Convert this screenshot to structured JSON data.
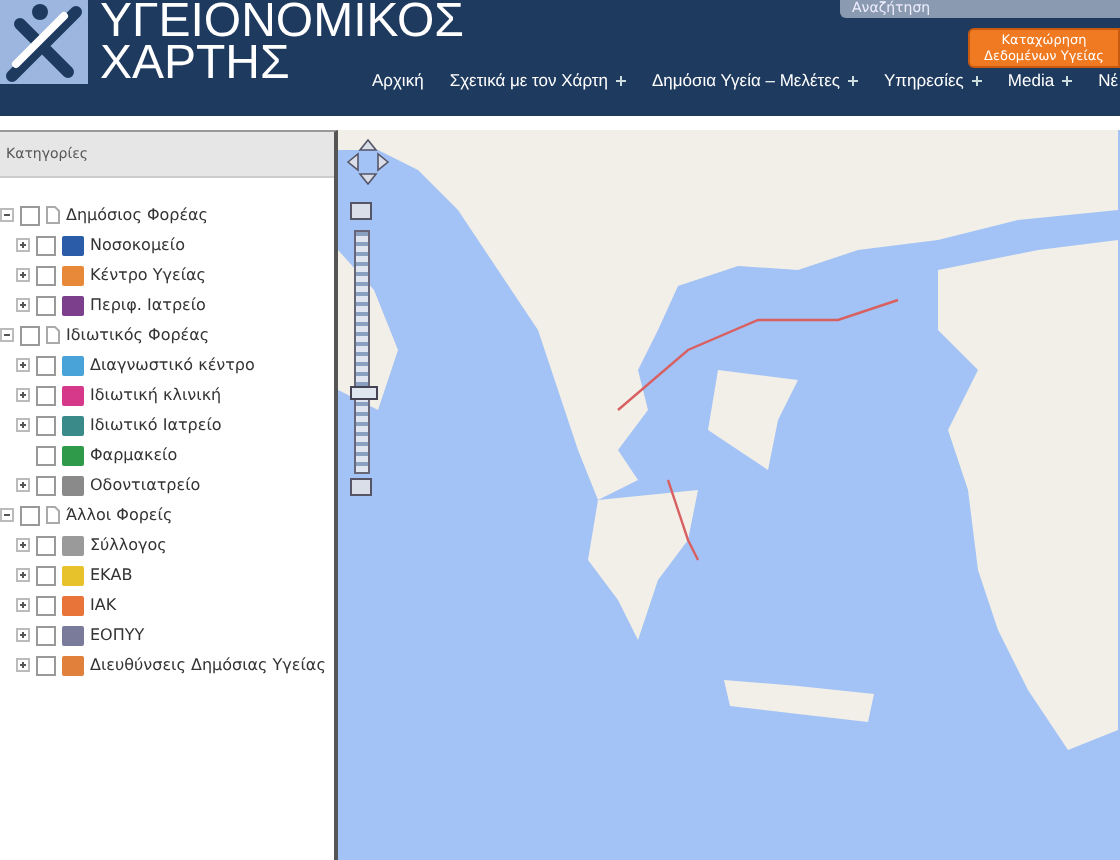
{
  "header": {
    "logo_line_1": "ΥΓΕΙΟΝΟΜΙΚΟΣ",
    "logo_line_2": "ΧΑΡΤΗΣ",
    "search": {
      "placeholder": "Αναζήτηση"
    },
    "register_button": "Καταχώρηση Δεδομένων Υγείας"
  },
  "nav": [
    {
      "label": "Αρχική",
      "expander": false
    },
    {
      "label": "Σχετικά με τον Χάρτη",
      "expander": true
    },
    {
      "label": "Δημόσια Υγεία – Μελέτες",
      "expander": true
    },
    {
      "label": "Υπηρεσίες",
      "expander": true
    },
    {
      "label": "Media",
      "expander": true
    },
    {
      "label": "Νέ",
      "expander": false
    }
  ],
  "sidebar": {
    "title": "Κατηγορίες",
    "tree": [
      {
        "label": "Δημόσιος Φορέας",
        "kind": "group",
        "expanded": true,
        "checked": false,
        "children": [
          {
            "label": "Νοσοκομείο",
            "kind": "category",
            "expanded": false,
            "checked": false,
            "color": "#2a5ca8"
          },
          {
            "label": "Κέντρο Υγείας",
            "kind": "category",
            "expanded": false,
            "checked": false,
            "color": "#e8893a"
          },
          {
            "label": "Περιφ. Ιατρείο",
            "kind": "category",
            "expanded": false,
            "checked": false,
            "color": "#7b3f8c"
          }
        ]
      },
      {
        "label": "Ιδιωτικός Φορέας",
        "kind": "group",
        "expanded": true,
        "checked": false,
        "children": [
          {
            "label": "Διαγνωστικό κέντρο",
            "kind": "category",
            "expanded": false,
            "checked": false,
            "color": "#4aa3d8"
          },
          {
            "label": "Ιδιωτική κλινική",
            "kind": "category",
            "expanded": false,
            "checked": false,
            "color": "#d6398a"
          },
          {
            "label": "Ιδιωτικό Ιατρείο",
            "kind": "category",
            "expanded": false,
            "checked": false,
            "color": "#3a8a8a"
          },
          {
            "label": "Φαρμακείο",
            "kind": "leaf",
            "checked": false,
            "color": "#2e9a4a"
          },
          {
            "label": "Οδοντιατρείο",
            "kind": "category",
            "expanded": false,
            "checked": false,
            "color": "#8a8a8a"
          }
        ]
      },
      {
        "label": "Άλλοι Φορείς",
        "kind": "group",
        "expanded": true,
        "checked": false,
        "children": [
          {
            "label": "Σύλλογος",
            "kind": "category",
            "expanded": false,
            "checked": false,
            "color": "#9a9a9a"
          },
          {
            "label": "ΕΚΑΒ",
            "kind": "category",
            "expanded": false,
            "checked": false,
            "color": "#e8c22a"
          },
          {
            "label": "ΙΑΚ",
            "kind": "category",
            "expanded": false,
            "checked": false,
            "color": "#e8743a"
          },
          {
            "label": "ΕΟΠΥΥ",
            "kind": "category",
            "expanded": false,
            "checked": false,
            "color": "#7a7a9a"
          },
          {
            "label": "Διευθύνσεις Δημόσιας Υγείας",
            "kind": "category",
            "expanded": false,
            "checked": false,
            "color": "#e0803a"
          }
        ]
      }
    ]
  },
  "map": {
    "zoom": {
      "level": 0.33
    }
  }
}
